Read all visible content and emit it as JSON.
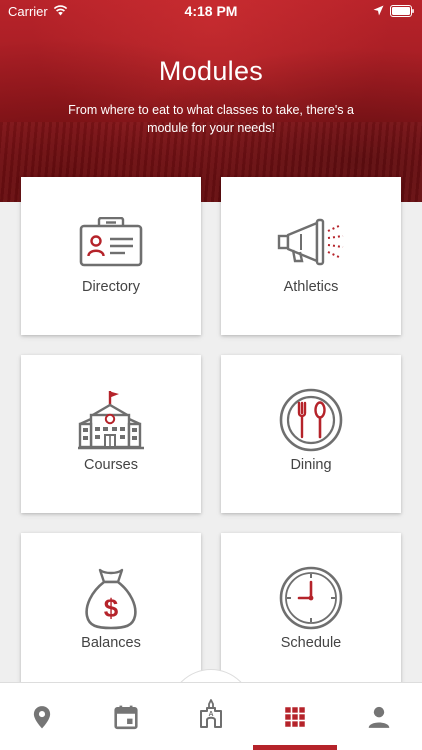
{
  "status_bar": {
    "carrier": "Carrier",
    "time": "4:18 PM"
  },
  "header": {
    "title": "Modules",
    "subtitle": "From where to eat to what classes to take, there's a module for your needs!"
  },
  "modules": [
    {
      "label": "Directory",
      "icon": "id-card-icon"
    },
    {
      "label": "Athletics",
      "icon": "megaphone-icon"
    },
    {
      "label": "Courses",
      "icon": "school-building-icon"
    },
    {
      "label": "Dining",
      "icon": "plate-fork-spoon-icon"
    },
    {
      "label": "Balances",
      "icon": "money-bag-icon"
    },
    {
      "label": "Schedule",
      "icon": "clock-icon"
    }
  ],
  "tab_bar": {
    "items": [
      {
        "icon": "map-pin-icon"
      },
      {
        "icon": "calendar-icon"
      },
      {
        "icon": "campus-home-icon"
      },
      {
        "icon": "grid-icon"
      },
      {
        "icon": "person-icon"
      }
    ],
    "active_index": 3
  },
  "colors": {
    "brand_red": "#b5232a",
    "icon_gray": "#6f6f6f",
    "inactive_tab": "#757575"
  }
}
